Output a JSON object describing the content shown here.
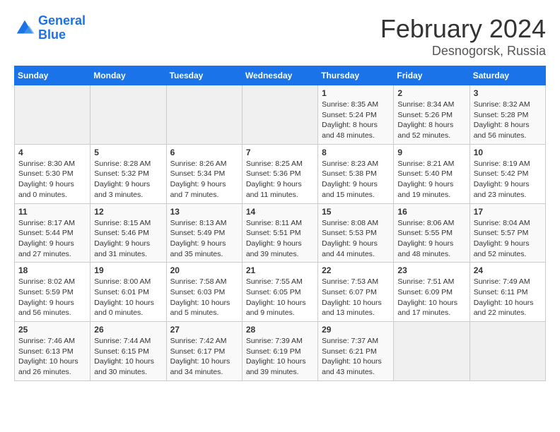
{
  "header": {
    "logo_line1": "General",
    "logo_line2": "Blue",
    "month_title": "February 2024",
    "location": "Desnogorsk, Russia"
  },
  "days_of_week": [
    "Sunday",
    "Monday",
    "Tuesday",
    "Wednesday",
    "Thursday",
    "Friday",
    "Saturday"
  ],
  "weeks": [
    [
      {
        "day": "",
        "info": ""
      },
      {
        "day": "",
        "info": ""
      },
      {
        "day": "",
        "info": ""
      },
      {
        "day": "",
        "info": ""
      },
      {
        "day": "1",
        "info": "Sunrise: 8:35 AM\nSunset: 5:24 PM\nDaylight: 8 hours\nand 48 minutes."
      },
      {
        "day": "2",
        "info": "Sunrise: 8:34 AM\nSunset: 5:26 PM\nDaylight: 8 hours\nand 52 minutes."
      },
      {
        "day": "3",
        "info": "Sunrise: 8:32 AM\nSunset: 5:28 PM\nDaylight: 8 hours\nand 56 minutes."
      }
    ],
    [
      {
        "day": "4",
        "info": "Sunrise: 8:30 AM\nSunset: 5:30 PM\nDaylight: 9 hours\nand 0 minutes."
      },
      {
        "day": "5",
        "info": "Sunrise: 8:28 AM\nSunset: 5:32 PM\nDaylight: 9 hours\nand 3 minutes."
      },
      {
        "day": "6",
        "info": "Sunrise: 8:26 AM\nSunset: 5:34 PM\nDaylight: 9 hours\nand 7 minutes."
      },
      {
        "day": "7",
        "info": "Sunrise: 8:25 AM\nSunset: 5:36 PM\nDaylight: 9 hours\nand 11 minutes."
      },
      {
        "day": "8",
        "info": "Sunrise: 8:23 AM\nSunset: 5:38 PM\nDaylight: 9 hours\nand 15 minutes."
      },
      {
        "day": "9",
        "info": "Sunrise: 8:21 AM\nSunset: 5:40 PM\nDaylight: 9 hours\nand 19 minutes."
      },
      {
        "day": "10",
        "info": "Sunrise: 8:19 AM\nSunset: 5:42 PM\nDaylight: 9 hours\nand 23 minutes."
      }
    ],
    [
      {
        "day": "11",
        "info": "Sunrise: 8:17 AM\nSunset: 5:44 PM\nDaylight: 9 hours\nand 27 minutes."
      },
      {
        "day": "12",
        "info": "Sunrise: 8:15 AM\nSunset: 5:46 PM\nDaylight: 9 hours\nand 31 minutes."
      },
      {
        "day": "13",
        "info": "Sunrise: 8:13 AM\nSunset: 5:49 PM\nDaylight: 9 hours\nand 35 minutes."
      },
      {
        "day": "14",
        "info": "Sunrise: 8:11 AM\nSunset: 5:51 PM\nDaylight: 9 hours\nand 39 minutes."
      },
      {
        "day": "15",
        "info": "Sunrise: 8:08 AM\nSunset: 5:53 PM\nDaylight: 9 hours\nand 44 minutes."
      },
      {
        "day": "16",
        "info": "Sunrise: 8:06 AM\nSunset: 5:55 PM\nDaylight: 9 hours\nand 48 minutes."
      },
      {
        "day": "17",
        "info": "Sunrise: 8:04 AM\nSunset: 5:57 PM\nDaylight: 9 hours\nand 52 minutes."
      }
    ],
    [
      {
        "day": "18",
        "info": "Sunrise: 8:02 AM\nSunset: 5:59 PM\nDaylight: 9 hours\nand 56 minutes."
      },
      {
        "day": "19",
        "info": "Sunrise: 8:00 AM\nSunset: 6:01 PM\nDaylight: 10 hours\nand 0 minutes."
      },
      {
        "day": "20",
        "info": "Sunrise: 7:58 AM\nSunset: 6:03 PM\nDaylight: 10 hours\nand 5 minutes."
      },
      {
        "day": "21",
        "info": "Sunrise: 7:55 AM\nSunset: 6:05 PM\nDaylight: 10 hours\nand 9 minutes."
      },
      {
        "day": "22",
        "info": "Sunrise: 7:53 AM\nSunset: 6:07 PM\nDaylight: 10 hours\nand 13 minutes."
      },
      {
        "day": "23",
        "info": "Sunrise: 7:51 AM\nSunset: 6:09 PM\nDaylight: 10 hours\nand 17 minutes."
      },
      {
        "day": "24",
        "info": "Sunrise: 7:49 AM\nSunset: 6:11 PM\nDaylight: 10 hours\nand 22 minutes."
      }
    ],
    [
      {
        "day": "25",
        "info": "Sunrise: 7:46 AM\nSunset: 6:13 PM\nDaylight: 10 hours\nand 26 minutes."
      },
      {
        "day": "26",
        "info": "Sunrise: 7:44 AM\nSunset: 6:15 PM\nDaylight: 10 hours\nand 30 minutes."
      },
      {
        "day": "27",
        "info": "Sunrise: 7:42 AM\nSunset: 6:17 PM\nDaylight: 10 hours\nand 34 minutes."
      },
      {
        "day": "28",
        "info": "Sunrise: 7:39 AM\nSunset: 6:19 PM\nDaylight: 10 hours\nand 39 minutes."
      },
      {
        "day": "29",
        "info": "Sunrise: 7:37 AM\nSunset: 6:21 PM\nDaylight: 10 hours\nand 43 minutes."
      },
      {
        "day": "",
        "info": ""
      },
      {
        "day": "",
        "info": ""
      }
    ]
  ]
}
